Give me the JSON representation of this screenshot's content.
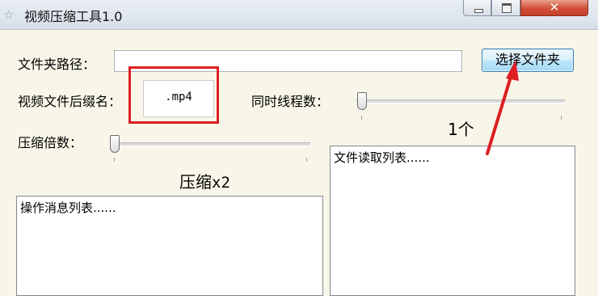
{
  "window": {
    "title": "视频压缩工具1.0",
    "icon": "app-star-icon",
    "controls": {
      "minimize": "minimize-icon",
      "maximize": "maximize-icon",
      "close": "✕"
    }
  },
  "form": {
    "folder_label": "文件夹路径：",
    "folder_value": "",
    "select_folder_button": "选择文件夹",
    "extension_label": "视频文件后缀名：",
    "extension_value": ".mp4",
    "threads_label": "同时线程数：",
    "threads_value": "1个",
    "threads_slider_level": 0,
    "compress_label": "压缩倍数：",
    "compress_value_prefix": "压缩",
    "compress_value_suffix": "x2",
    "compress_slider_level": 0
  },
  "lists": {
    "message_list_item": "操作消息列表......",
    "file_list_item": "文件读取列表......"
  },
  "annotations": {
    "highlight_color": "#dd1f23",
    "arrow_color": "#dd1f23"
  }
}
